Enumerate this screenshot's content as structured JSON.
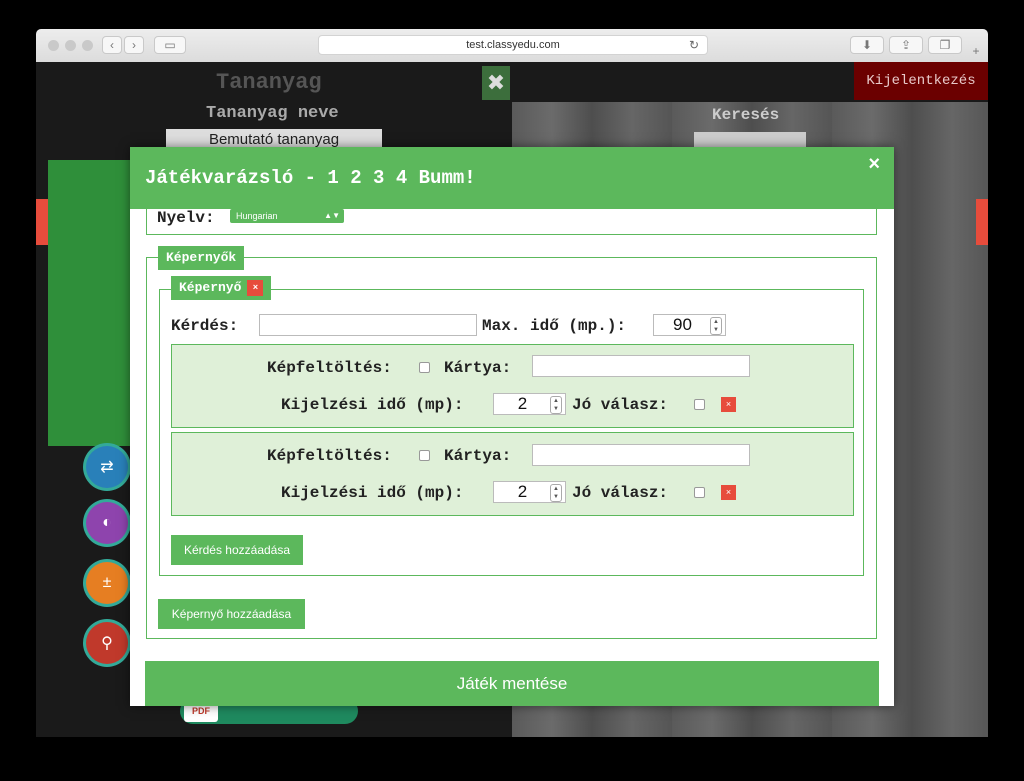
{
  "browser": {
    "url": "test.classyedu.com"
  },
  "background": {
    "title": "Tananyag",
    "subtitle": "Tananyag neve",
    "material_value": "Bemutató tananyag",
    "logout_label": "Kijelentkezés",
    "search_label": "Keresés",
    "pdf_label": "PDF"
  },
  "modal": {
    "title": "Játékvarázsló - 1 2 3 4 Bumm!",
    "close_label": "×",
    "language_label": "Nyelv:",
    "language_value": "Hungarian",
    "screens_legend": "Képernyők",
    "screen_legend": "Képernyő",
    "remove_label": "×",
    "question_label": "Kérdés:",
    "question_value": "",
    "max_time_label": "Max. idő (mp.):",
    "max_time_value": "90",
    "cards": [
      {
        "upload_label": "Képfeltöltés:",
        "card_label": "Kártya:",
        "card_value": "",
        "display_time_label": "Kijelzési idő (mp):",
        "display_time_value": "2",
        "correct_label": "Jó válasz:",
        "remove_label": "×"
      },
      {
        "upload_label": "Képfeltöltés:",
        "card_label": "Kártya:",
        "card_value": "",
        "display_time_label": "Kijelzési idő (mp):",
        "display_time_value": "2",
        "correct_label": "Jó válasz:",
        "remove_label": "×"
      }
    ],
    "add_question_label": "Kérdés hozzáadása",
    "add_screen_label": "Képernyő hozzáadása",
    "save_label": "Játék mentése"
  },
  "colors": {
    "accent_green": "#5cb85c",
    "danger_red": "#e74c3c",
    "panel_green": "#dff0d8"
  }
}
